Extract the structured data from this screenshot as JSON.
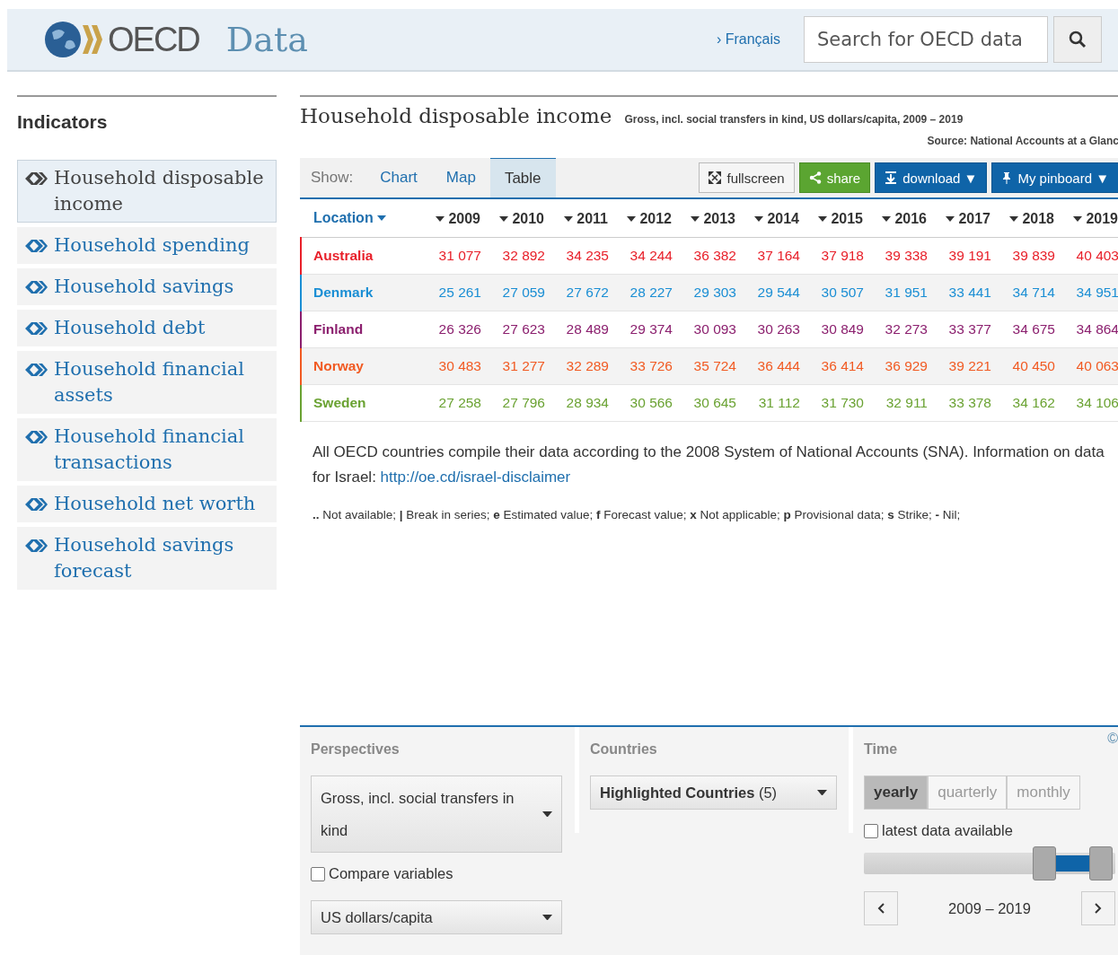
{
  "header": {
    "logo_text": "OECD",
    "site_title": "Data",
    "language_link": "› Français",
    "search": {
      "placeholder": "Search for OECD data"
    }
  },
  "sidebar": {
    "title": "Indicators",
    "items": [
      {
        "label": "Household disposable income",
        "selected": true
      },
      {
        "label": "Household spending",
        "selected": false
      },
      {
        "label": "Household savings",
        "selected": false
      },
      {
        "label": "Household debt",
        "selected": false
      },
      {
        "label": "Household financial assets",
        "selected": false
      },
      {
        "label": "Household financial transactions",
        "selected": false
      },
      {
        "label": "Household net worth",
        "selected": false
      },
      {
        "label": "Household savings forecast",
        "selected": false
      }
    ]
  },
  "main": {
    "title": "Household disposable income",
    "subtitle": "Gross, incl. social transfers in kind, US dollars/capita, 2009 – 2019",
    "source": "Source: National Accounts at a Glanc",
    "show_label": "Show:",
    "tabs": [
      {
        "label": "Chart",
        "selected": false
      },
      {
        "label": "Map",
        "selected": false
      },
      {
        "label": "Table",
        "selected": true
      }
    ],
    "buttons": [
      {
        "kind": "plain",
        "label": "fullscreen"
      },
      {
        "kind": "green",
        "label": "share"
      },
      {
        "kind": "blue",
        "label": "download ▼"
      },
      {
        "kind": "blue",
        "label": "My pinboard ▼"
      }
    ],
    "table": {
      "columns": [
        "Location",
        "2009",
        "2010",
        "2011",
        "2012",
        "2013",
        "2014",
        "2015",
        "2016",
        "2017",
        "2018",
        "2019"
      ],
      "rows": [
        {
          "country": "Australia",
          "color": "#e8202a",
          "values": [
            "31 077",
            "32 892",
            "34 235",
            "34 244",
            "36 382",
            "37 164",
            "37 918",
            "39 338",
            "39 191",
            "39 839",
            "40 403"
          ]
        },
        {
          "country": "Denmark",
          "color": "#1a8ed4",
          "values": [
            "25 261",
            "27 059",
            "27 672",
            "28 227",
            "29 303",
            "29 544",
            "30 507",
            "31 951",
            "33 441",
            "34 714",
            "34 951"
          ]
        },
        {
          "country": "Finland",
          "color": "#8b1f6e",
          "values": [
            "26 326",
            "27 623",
            "28 489",
            "29 374",
            "30 093",
            "30 263",
            "30 849",
            "32 273",
            "33 377",
            "34 675",
            "34 864"
          ]
        },
        {
          "country": "Norway",
          "color": "#f15a22",
          "values": [
            "30 483",
            "31 277",
            "32 289",
            "33 726",
            "35 724",
            "36 444",
            "36 414",
            "36 929",
            "39 221",
            "40 450",
            "40 063"
          ]
        },
        {
          "country": "Sweden",
          "color": "#6aa232",
          "values": [
            "27 258",
            "27 796",
            "28 934",
            "30 566",
            "30 645",
            "31 112",
            "31 730",
            "32 911",
            "33 378",
            "34 162",
            "34 106"
          ]
        }
      ]
    },
    "note": "All OECD countries compile their data according to the 2008 System of National Accounts (SNA). Information on data for Israel: ",
    "note_link": "http://oe.cd/israel-disclaimer",
    "legend": "**..** Not available; **|** Break in series; **e** Estimated value; **f** Forecast value; **x** Not applicable; **p** Provisional data; **s** Strike; **-** Nil;"
  },
  "controls": {
    "copyright": "©",
    "perspectives": {
      "title": "Perspectives",
      "measure": "Gross, incl. social transfers in kind",
      "compare": {
        "label": "Compare variables",
        "checked": false
      },
      "unit": "US dollars/capita"
    },
    "countries": {
      "title": "Countries",
      "selector": "**Highlighted Countries** (5)"
    },
    "time": {
      "title": "Time",
      "frequencies": [
        {
          "label": "yearly",
          "selected": true
        },
        {
          "label": "quarterly",
          "selected": false
        },
        {
          "label": "monthly",
          "selected": false
        }
      ],
      "latest": {
        "label": "latest data available",
        "checked": false
      },
      "slider": [
        {
          "level": 0.74
        },
        {
          "level": 0.99
        }
      ],
      "range": "2009 – 2019"
    }
  }
}
